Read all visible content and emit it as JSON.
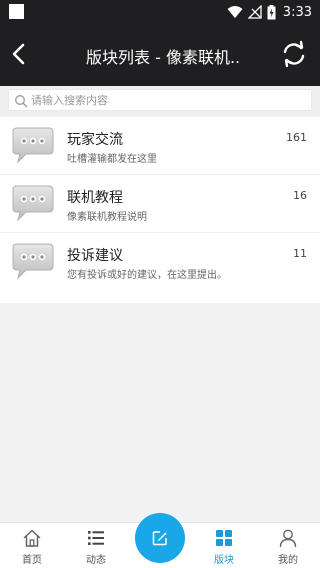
{
  "status_bar": {
    "time": "3:33"
  },
  "header": {
    "title": "版块列表 - 像素联机.."
  },
  "search": {
    "placeholder": "请输入搜索内容"
  },
  "forums": [
    {
      "name": "玩家交流",
      "description": "吐槽灌输都发在这里",
      "count": "161"
    },
    {
      "name": "联机教程",
      "description": "像素联机教程说明",
      "count": "16"
    },
    {
      "name": "投诉建议",
      "description": "您有投诉或好的建议，在这里提出。",
      "count": "11"
    }
  ],
  "tabbar": {
    "tabs": [
      {
        "label": "首页",
        "icon": "home-icon"
      },
      {
        "label": "动态",
        "icon": "list-icon"
      },
      {
        "label": "",
        "icon": "compose-icon"
      },
      {
        "label": "版块",
        "icon": "grid-icon"
      },
      {
        "label": "我的",
        "icon": "person-icon"
      }
    ],
    "active": "版块"
  },
  "colors": {
    "header_bg": "#1f1f21",
    "accent": "#1a9ad8",
    "fab": "#1aa7e8",
    "background": "#f2f2f2"
  }
}
